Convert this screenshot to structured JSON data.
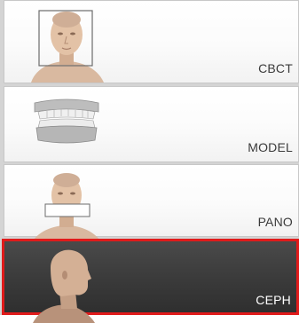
{
  "scan_modes": [
    {
      "label": "CBCT",
      "selected": false,
      "icon": "cbct-head-icon"
    },
    {
      "label": "MODEL",
      "selected": false,
      "icon": "dental-model-icon"
    },
    {
      "label": "PANO",
      "selected": false,
      "icon": "pano-head-icon"
    },
    {
      "label": "CEPH",
      "selected": true,
      "icon": "ceph-profile-icon"
    }
  ],
  "colors": {
    "selected_border": "#e01b1b",
    "selected_background": "#3a3a3a",
    "item_background": "#fafafa"
  }
}
